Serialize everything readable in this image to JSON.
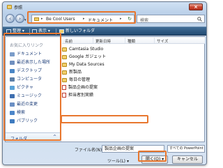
{
  "window": {
    "title": "参照",
    "close_label": "×"
  },
  "nav": {
    "back_icon": "back-arrow-icon",
    "forward_icon": "forward-arrow-icon",
    "breadcrumb": [
      "Be Cool Users",
      "ドキュメント"
    ],
    "search_placeholder": "検索"
  },
  "toolbar": {
    "organize": "整理",
    "views": "表示",
    "new_folder": "新しいフォルダ"
  },
  "sidebar": {
    "title": "お気に入りリンク",
    "items": [
      {
        "label": "ドキュメント",
        "icon": "documents-icon",
        "color": "#7a9cc9"
      },
      {
        "label": "最近表示した場所",
        "icon": "recent-places-icon",
        "color": "#6f8fbf"
      },
      {
        "label": "デスクトップ",
        "icon": "desktop-icon",
        "color": "#4a86c5"
      },
      {
        "label": "コンピュータ",
        "icon": "computer-icon",
        "color": "#5b7fa8"
      },
      {
        "label": "ピクチャ",
        "icon": "pictures-icon",
        "color": "#5aa3d8"
      },
      {
        "label": "ミュージック",
        "icon": "music-icon",
        "color": "#3f6fb0"
      },
      {
        "label": "最近の変更",
        "icon": "recent-changes-icon",
        "color": "#6a8fc4"
      },
      {
        "label": "検索",
        "icon": "search-folder-icon",
        "color": "#4c86c9"
      },
      {
        "label": "パブリック",
        "icon": "public-icon",
        "color": "#3e7bbf"
      }
    ],
    "folder_label": "フォルダ",
    "folder_chevron": "^"
  },
  "list": {
    "columns": [
      "名前",
      "更新日時",
      "種類",
      "サイズ"
    ],
    "files": [
      {
        "name": "Camtasia Studio",
        "kind": "folder"
      },
      {
        "name": "Google ガジェット",
        "kind": "folder"
      },
      {
        "name": "My Data Sources",
        "kind": "folder"
      },
      {
        "name": "新製品",
        "kind": "folder"
      },
      {
        "name": "毎日の管理",
        "kind": "folder"
      },
      {
        "name": "製品企画の提案",
        "kind": "doc"
      },
      {
        "name": "担当者別実績",
        "kind": "doc"
      }
    ]
  },
  "footer": {
    "filename_label": "ファイル名(N):",
    "filename_value": "製品企画の提案",
    "filetype_value": "すべての PowerPoint プレゼンテー",
    "tools_label": "ツール(L)",
    "open_label": "開く(O)",
    "cancel_label": "キャンセル"
  },
  "colors": {
    "highlight": "#e8772e",
    "toolbar": "#2d5a86"
  }
}
